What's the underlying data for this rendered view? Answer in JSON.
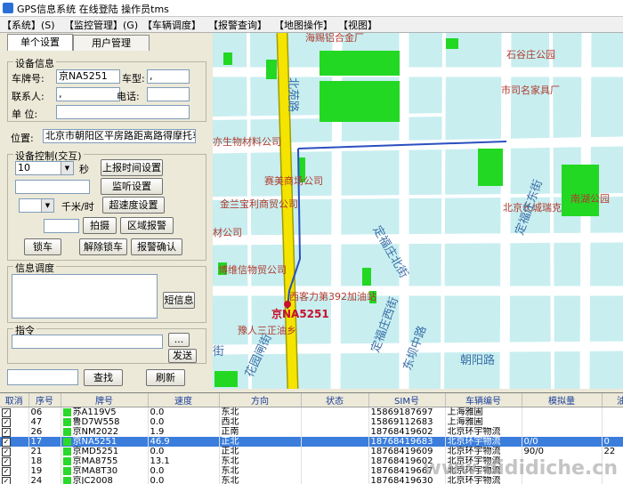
{
  "window": {
    "title": "GPS信息系统  在线登陆 操作员tms"
  },
  "menu": [
    {
      "label": "【系统】(S)"
    },
    {
      "label": "【监控管理】(G)"
    },
    {
      "label": "【车辆调度】"
    },
    {
      "label": "【报警查询】"
    },
    {
      "label": "【地图操作】"
    },
    {
      "label": "【视图】"
    }
  ],
  "tabs": [
    {
      "label": "单个设置"
    },
    {
      "label": "用户管理"
    }
  ],
  "device_info": {
    "group_label": "设备信息",
    "plate_label": "车牌号:",
    "plate_value": "京NA5251",
    "type_label": "车型:",
    "type_value": ",",
    "contact_label": "联系人:",
    "contact_value": ",",
    "phone_label": "电话:",
    "phone_value": "",
    "unit_label": "单  位:",
    "unit_value": ""
  },
  "location": {
    "label": "位置:",
    "value": "北京市朝阳区平房路距离路得摩托车"
  },
  "device_control": {
    "group_label": "设备控制(交互)",
    "interval_value": "10",
    "seconds_label": "秒",
    "report_time_button": "上报时间设置",
    "monitor_value": "",
    "monitor_button": "监听设置",
    "speed_unit_label": "千米/时",
    "overspeed_button": "超速度设置",
    "photo_button": "拍摄",
    "area_alarm_button": "区域报警",
    "lock_button": "锁车",
    "unlock_button": "解除锁车",
    "alarm_confirm_button": "报警确认"
  },
  "dispatch": {
    "group_label": "信息调度",
    "message_value": "",
    "short_msg_button": "短信息"
  },
  "command": {
    "group_label": "指令",
    "value": "",
    "more_button": "...",
    "send_button": "发送"
  },
  "search": {
    "value": "",
    "find_button": "查找",
    "refresh_button": "刷新"
  },
  "map": {
    "labels": [
      {
        "text": "海赐铝合金厂"
      },
      {
        "text": "石谷庄公园"
      },
      {
        "text": "市司名家具厂"
      },
      {
        "text": "亦生物材料公司"
      },
      {
        "text": "赛美商场公司"
      },
      {
        "text": "金兰宝利商贸公司"
      },
      {
        "text": "北京长城瑞克"
      },
      {
        "text": "南湖公园"
      },
      {
        "text": "材公司"
      },
      {
        "text": "博维信物贸公司"
      },
      {
        "text": "西客力第392加油站"
      },
      {
        "text": "豫人三正油乡"
      }
    ],
    "roads": [
      {
        "text": "北苑路"
      },
      {
        "text": "朝阳路"
      },
      {
        "text": "定福庄北街"
      },
      {
        "text": "定福庄东街"
      },
      {
        "text": "定福庄西街"
      },
      {
        "text": "东坝中路"
      },
      {
        "text": "花园闸街"
      },
      {
        "text": "街"
      }
    ],
    "vehicle_label": "京NA5251",
    "colors": {
      "road_main": "#f5e400",
      "water": "#c8eef0",
      "park": "#22d822",
      "route": "#2a4fc0",
      "vehicle": "#c8102e"
    }
  },
  "grid": {
    "columns": [
      "取消",
      "序号",
      "牌号",
      "速度",
      "方向",
      "状态",
      "SIM号",
      "车辆编号",
      "模拟量",
      "油"
    ],
    "rows": [
      {
        "checked": true,
        "seq": "06",
        "plate": "苏A119V5",
        "speed": "0.0",
        "dir": "东北",
        "state": "",
        "sim": "15869187697",
        "vno": "上海雅圃",
        "analog": "",
        "oil": ""
      },
      {
        "checked": true,
        "seq": "47",
        "plate": "鲁D7W558",
        "speed": "0.0",
        "dir": "西北",
        "state": "",
        "sim": "15869112683",
        "vno": "上海雅圃",
        "analog": "",
        "oil": ""
      },
      {
        "checked": true,
        "seq": "26",
        "plate": "京NM2022",
        "speed": "1.9",
        "dir": "正南",
        "state": "",
        "sim": "18768419602",
        "vno": "北京环宇物流",
        "analog": "",
        "oil": ""
      },
      {
        "checked": true,
        "seq": "17",
        "plate": "京NA5251",
        "speed": "46.9",
        "dir": "正北",
        "state": "",
        "sim": "18768419683",
        "vno": "北京环宇物流",
        "analog": "0/0",
        "oil": "0",
        "selected": true
      },
      {
        "checked": true,
        "seq": "21",
        "plate": "京MD5251",
        "speed": "0.0",
        "dir": "正北",
        "state": "",
        "sim": "18768419609",
        "vno": "北京环宇物流",
        "analog": "90/0",
        "oil": "22"
      },
      {
        "checked": true,
        "seq": "18",
        "plate": "京MA8755",
        "speed": "13.1",
        "dir": "东北",
        "state": "",
        "sim": "18768419602",
        "vno": "北京环宇物流",
        "analog": "",
        "oil": ""
      },
      {
        "checked": true,
        "seq": "19",
        "plate": "京MA8T30",
        "speed": "0.0",
        "dir": "东北",
        "state": "",
        "sim": "18768419667",
        "vno": "北京环宇物流",
        "analog": "",
        "oil": ""
      },
      {
        "checked": true,
        "seq": "24",
        "plate": "京JC2008",
        "speed": "0.0",
        "dir": "东北",
        "state": "",
        "sim": "18768419630",
        "vno": "北京环宇物流",
        "analog": "",
        "oil": ""
      }
    ]
  },
  "watermark": "www.dididiche.cn"
}
